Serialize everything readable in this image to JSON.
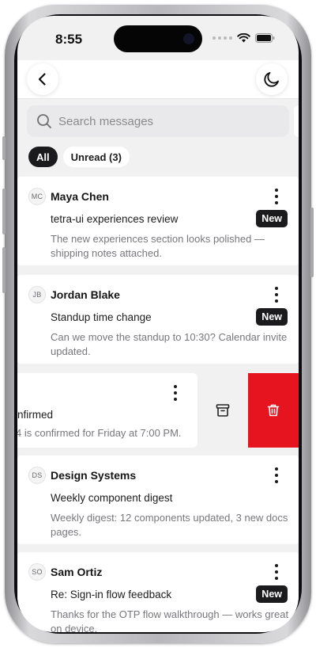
{
  "status_bar": {
    "time": "8:55"
  },
  "top_bar": {
    "back_icon": "chevron-left-icon",
    "theme_icon": "moon-icon"
  },
  "search": {
    "placeholder": "Search messages",
    "icon": "search-icon"
  },
  "filters": [
    {
      "label": "All",
      "active": true
    },
    {
      "label": "Unread (3)",
      "active": false
    }
  ],
  "messages": [
    {
      "initials": "MC",
      "sender": "Maya Chen",
      "subject": "tetra-ui experiences review",
      "badge": "New",
      "preview": "The new experiences section looks polished — shipping notes attached."
    },
    {
      "initials": "JB",
      "sender": "Jordan Blake",
      "subject": "Standup time change",
      "badge": "New",
      "preview": "Can we move the standup to 10:30? Calendar invite updated."
    },
    {
      "swiped": true,
      "subject_fragment": "nfirmed",
      "preview_fragment": "4 is confirmed for Friday at 7:00 PM.",
      "actions": {
        "archive_icon": "archive-icon",
        "delete_icon": "trash-icon"
      }
    },
    {
      "initials": "DS",
      "sender": "Design Systems",
      "subject": "Weekly component digest",
      "preview": "Weekly digest: 12 components updated, 3 new docs pages."
    },
    {
      "initials": "SO",
      "sender": "Sam Ortiz",
      "subject": "Re: Sign-in flow feedback",
      "badge": "New",
      "preview": "Thanks for the OTP flow walkthrough — works great on device."
    }
  ],
  "colors": {
    "accent_dark": "#1b1b1d",
    "delete_red": "#e5141f",
    "background": "#f1f1f2"
  }
}
